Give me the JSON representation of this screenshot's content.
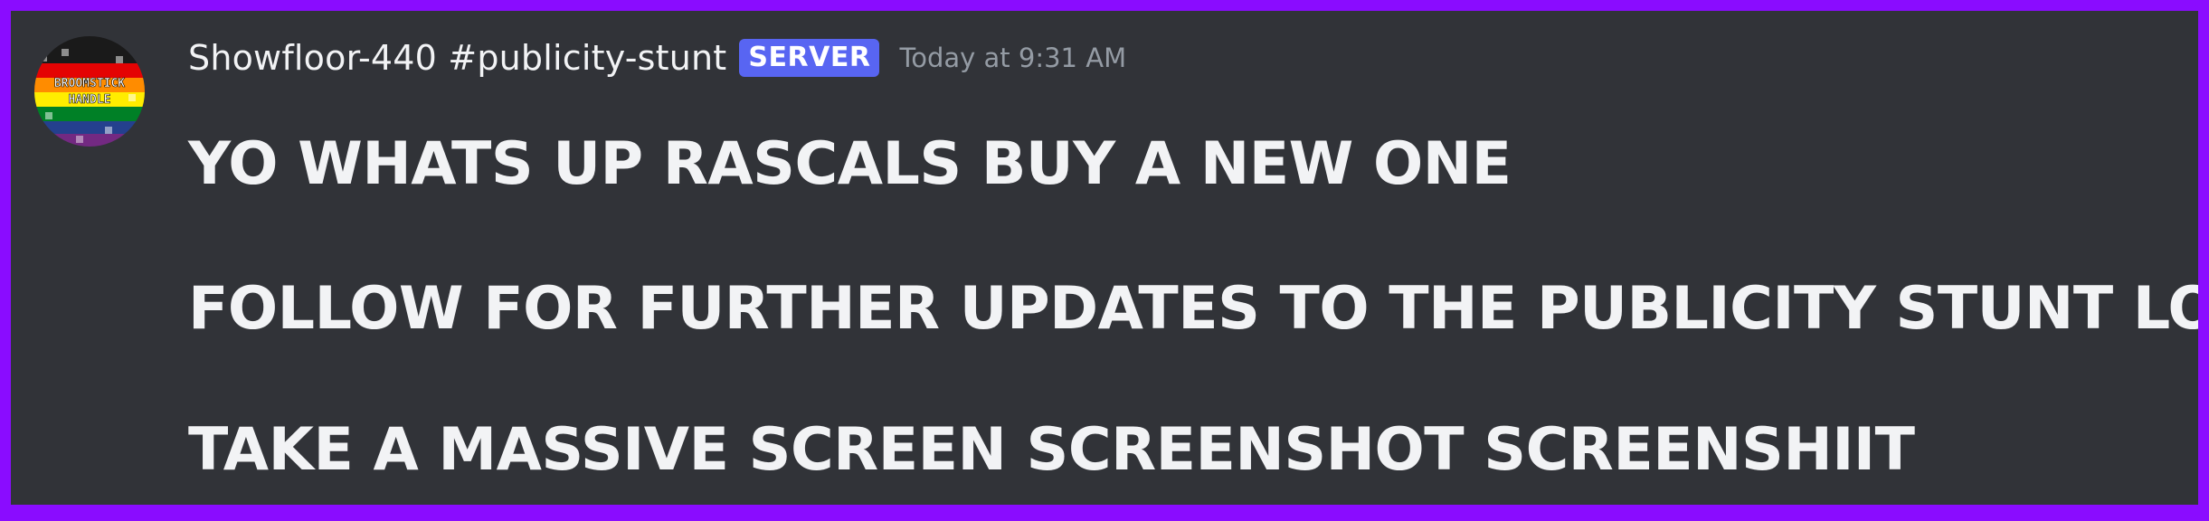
{
  "message": {
    "author": "Showfloor-440 #publicity-stunt",
    "badge": "SERVER",
    "timestamp": "Today at 9:31 AM",
    "lines": [
      "YO WHATS UP RASCALS BUY A NEW ONE",
      "FOLLOW FOR FURTHER UPDATES TO THE PUBLICITY STUNT LORE",
      "TAKE A MASSIVE SCREEN SCREENSHOT SCREENSHIIT"
    ]
  },
  "avatar": {
    "text_top": "BROOMSTICK",
    "text_bottom": "HANDLE",
    "stripe_colors": [
      "#1a1a1a",
      "#e40303",
      "#ff8c00",
      "#ffed00",
      "#008026",
      "#24408e",
      "#732982"
    ]
  },
  "colors": {
    "frame_border": "#8a0cff",
    "background": "#313338",
    "text": "#f2f3f5",
    "badge": "#5865f2",
    "timestamp": "#949ba4"
  }
}
